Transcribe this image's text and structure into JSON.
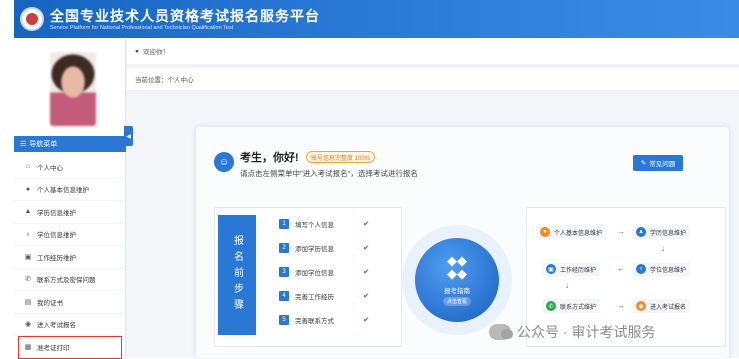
{
  "header": {
    "title": "全国专业技术人员资格考试报名服务平台",
    "subtitle": "Service Platform for National Professional and Technician Qualification Test"
  },
  "topbar": {
    "welcome": "欢迎你！"
  },
  "breadcrumb": "当前位置：个人中心",
  "sidebar": {
    "menu_title": "导航菜单",
    "items": [
      {
        "label": "个人中心",
        "icon": "home-icon"
      },
      {
        "label": "个人基本信息维护",
        "icon": "person-icon"
      },
      {
        "label": "学历信息维护",
        "icon": "graduation-icon"
      },
      {
        "label": "学位信息维护",
        "icon": "degree-icon"
      },
      {
        "label": "工作经历维护",
        "icon": "briefcase-icon"
      },
      {
        "label": "联系方式及密保问题",
        "icon": "phone-icon"
      },
      {
        "label": "我的证书",
        "icon": "certificate-icon"
      },
      {
        "label": "进入考试报名",
        "icon": "enter-icon"
      },
      {
        "label": "准考证打印",
        "icon": "print-icon"
      }
    ]
  },
  "main": {
    "greeting": "考生，你好!",
    "completion_badge": "账号信息完整度 100%",
    "hint": "请点击左侧菜单中\"进入考试报名\"，选择考试进行报名",
    "faq_button": "常见问题",
    "steps_title": "报名前步骤",
    "steps": [
      {
        "num": "1",
        "label": "填写个人信息"
      },
      {
        "num": "2",
        "label": "添加学历信息"
      },
      {
        "num": "3",
        "label": "添加学位信息"
      },
      {
        "num": "4",
        "label": "完善工作经历"
      },
      {
        "num": "5",
        "label": "完善联系方式"
      }
    ],
    "guide_label": "报考指南",
    "guide_sub": "点击查看",
    "flow": [
      {
        "label": "个人基本信息维护",
        "icon": "person-icon"
      },
      {
        "label": "学历信息维护",
        "icon": "graduation-icon"
      },
      {
        "label": "学位信息维护",
        "icon": "degree-icon"
      },
      {
        "label": "工作经历维护",
        "icon": "briefcase-icon"
      },
      {
        "label": "联系方式维护",
        "icon": "phone-icon"
      },
      {
        "label": "进入考试报名",
        "icon": "enter-icon"
      }
    ]
  },
  "watermark": "公众号 · 审计考试服务",
  "colors": {
    "primary": "#2a78d6",
    "highlight": "#e53935",
    "badge": "#e07f12",
    "check": "#2ea44f"
  }
}
